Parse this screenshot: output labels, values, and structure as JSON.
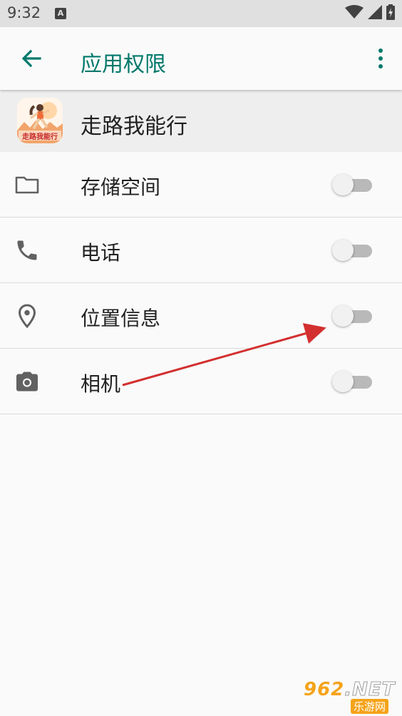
{
  "status_bar": {
    "time": "9:32",
    "notification_badge": "A",
    "icons": [
      "wifi-icon",
      "cell-signal-icon",
      "battery-charging-icon"
    ]
  },
  "app_bar": {
    "title": "应用权限",
    "back_icon": "arrow-back-icon",
    "more_icon": "more-vert-icon",
    "accent_color": "#00796b"
  },
  "app": {
    "name": "走路我能行",
    "icon_text": "走路我能行"
  },
  "permissions": [
    {
      "label": "存储空间",
      "icon": "folder-icon",
      "enabled": false
    },
    {
      "label": "电话",
      "icon": "phone-icon",
      "enabled": false
    },
    {
      "label": "位置信息",
      "icon": "location-pin-icon",
      "enabled": false
    },
    {
      "label": "相机",
      "icon": "camera-icon",
      "enabled": false
    }
  ],
  "annotation": {
    "arrow_color": "#d32f2f"
  },
  "watermark": {
    "brand": "962",
    "suffix": ".NET",
    "subtitle": "乐游网"
  }
}
